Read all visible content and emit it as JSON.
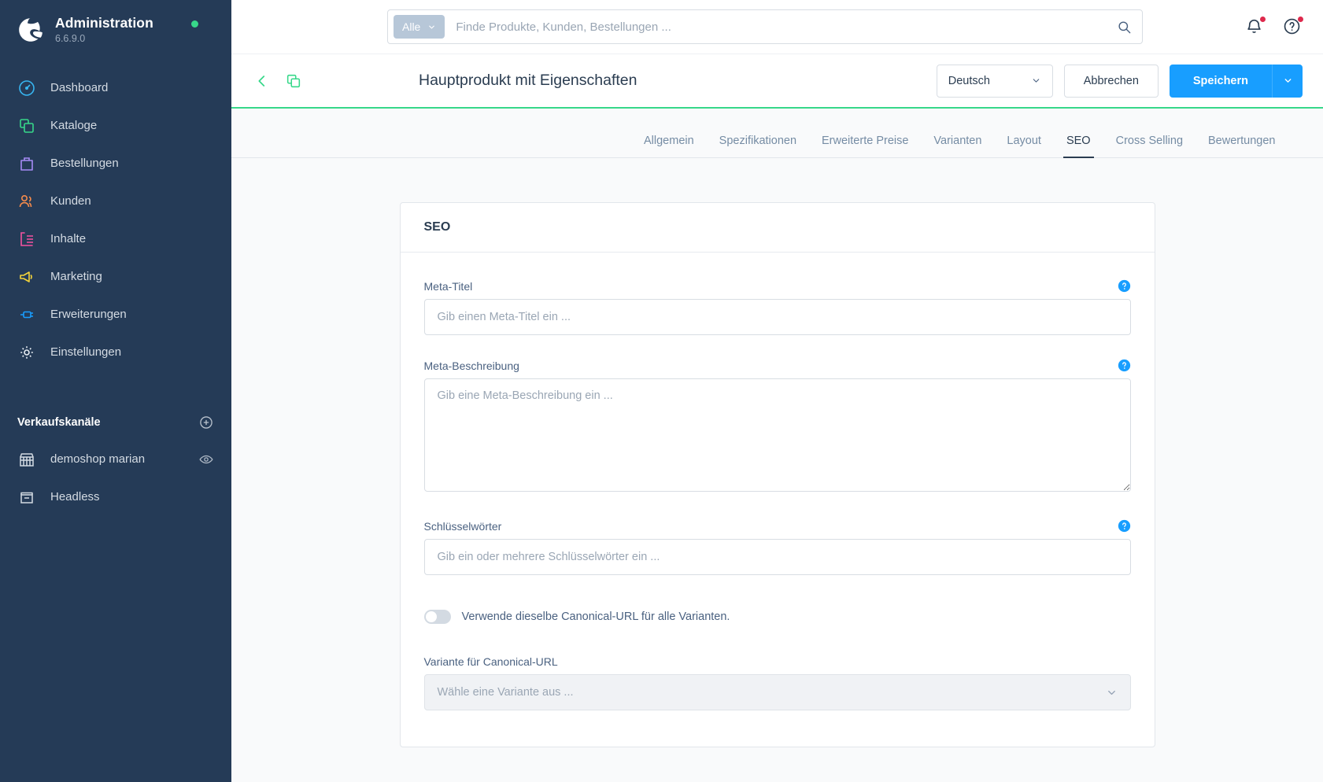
{
  "sidebar": {
    "brand": {
      "title": "Administration",
      "version": "6.6.9.0",
      "status_color": "#37d88a"
    },
    "items": [
      {
        "label": "Dashboard",
        "icon": "dashboard-icon",
        "color": "#37b5f0"
      },
      {
        "label": "Kataloge",
        "icon": "catalog-icon",
        "color": "#37d88a"
      },
      {
        "label": "Bestellungen",
        "icon": "orders-icon",
        "color": "#a78bf5"
      },
      {
        "label": "Kunden",
        "icon": "customers-icon",
        "color": "#f58b4c"
      },
      {
        "label": "Inhalte",
        "icon": "content-icon",
        "color": "#f552a0"
      },
      {
        "label": "Marketing",
        "icon": "marketing-icon",
        "color": "#f5d43a"
      },
      {
        "label": "Erweiterungen",
        "icon": "extensions-icon",
        "color": "#189eff"
      },
      {
        "label": "Einstellungen",
        "icon": "settings-icon",
        "color": "#ffffff"
      }
    ],
    "section": {
      "title": "Verkaufskanäle",
      "add_icon": "plus-circle-icon"
    },
    "channels": [
      {
        "label": "demoshop marian",
        "icon": "storefront-icon",
        "action_icon": "eye-icon",
        "has_action": true
      },
      {
        "label": "Headless",
        "icon": "headless-icon",
        "action_icon": "",
        "has_action": false
      }
    ]
  },
  "topbar": {
    "search": {
      "scope_label": "Alle",
      "placeholder": "Finde Produkte, Kunden, Bestellungen ...",
      "value": "",
      "search_icon": "search-icon",
      "caret_icon": "chevron-down-icon"
    },
    "notifications_icon": "bell-icon",
    "help_icon": "question-circle-icon",
    "notifications_badge": true,
    "help_badge": true
  },
  "header": {
    "back_icon": "chevron-left-icon",
    "duplicate_icon": "duplicate-icon",
    "title": "Hauptprodukt mit Eigenschaften",
    "language": {
      "value": "Deutsch",
      "caret_icon": "chevron-down-icon"
    },
    "cancel_label": "Abbrechen",
    "save_label": "Speichern",
    "save_caret_icon": "chevron-down-icon",
    "accent_color": "#189eff",
    "underline_color": "#37d88a"
  },
  "tabs": [
    {
      "label": "Allgemein",
      "active": false
    },
    {
      "label": "Spezifikationen",
      "active": false
    },
    {
      "label": "Erweiterte Preise",
      "active": false
    },
    {
      "label": "Varianten",
      "active": false
    },
    {
      "label": "Layout",
      "active": false
    },
    {
      "label": "SEO",
      "active": true
    },
    {
      "label": "Cross Selling",
      "active": false
    },
    {
      "label": "Bewertungen",
      "active": false
    }
  ],
  "seo_card": {
    "title": "SEO",
    "meta_title": {
      "label": "Meta-Titel",
      "placeholder": "Gib einen Meta-Titel ein ...",
      "value": "",
      "help_icon": "question-circle-icon"
    },
    "meta_description": {
      "label": "Meta-Beschreibung",
      "placeholder": "Gib eine Meta-Beschreibung ein ...",
      "value": "",
      "help_icon": "question-circle-icon"
    },
    "keywords": {
      "label": "Schlüsselwörter",
      "placeholder": "Gib ein oder mehrere Schlüsselwörter ein ...",
      "value": "",
      "help_icon": "question-circle-icon"
    },
    "canonical_toggle": {
      "label": "Verwende dieselbe Canonical-URL für alle Varianten.",
      "checked": false
    },
    "canonical_variant": {
      "label": "Variante für Canonical-URL",
      "placeholder": "Wähle eine Variante aus ...",
      "value": "",
      "disabled": true,
      "caret_icon": "chevron-down-icon"
    }
  }
}
